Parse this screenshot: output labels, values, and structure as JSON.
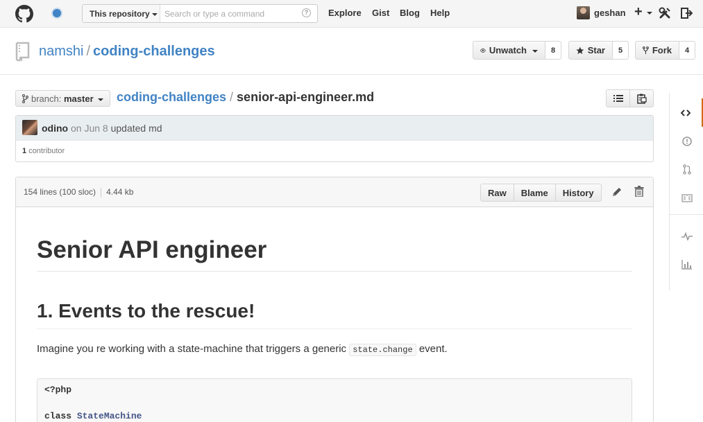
{
  "header": {
    "search_scope": "This repository",
    "search_placeholder": "Search or type a command",
    "help_glyph": "?",
    "nav": [
      "Explore",
      "Gist",
      "Blog",
      "Help"
    ],
    "username": "geshan",
    "new_glyph": "+"
  },
  "repo": {
    "owner": "namshi",
    "separator": "/",
    "name": "coding-challenges",
    "watch_label": "Unwatch",
    "watch_count": "8",
    "star_label": "Star",
    "star_count": "5",
    "fork_label": "Fork",
    "fork_count": "4"
  },
  "file_nav": {
    "branch_label": "branch:",
    "branch_name": "master",
    "crumb_repo": "coding-challenges",
    "crumb_sep": "/",
    "crumb_file": "senior-api-engineer.md"
  },
  "commit": {
    "author": "odino",
    "date": "on Jun 8",
    "message": "updated md",
    "contributor_count": "1",
    "contributor_label": "contributor"
  },
  "file": {
    "lines": "154 lines (100 sloc)",
    "size": "4.44 kb",
    "actions": [
      "Raw",
      "Blame",
      "History"
    ]
  },
  "content": {
    "h1": "Senior API engineer",
    "h2": "1. Events to the rescue!",
    "para_before": "Imagine you re working with a state-machine that triggers a generic ",
    "para_code": "state.change",
    "para_after": " event.",
    "code_line1": "<?php",
    "code_kw": "class",
    "code_class": "StateMachine"
  },
  "colors": {
    "link": "#4183c4",
    "active_tab": "#d26911"
  },
  "sidebar_icons": [
    "code-icon",
    "issue-icon",
    "pull-request-icon",
    "wiki-icon",
    "pulse-icon",
    "graph-icon"
  ]
}
